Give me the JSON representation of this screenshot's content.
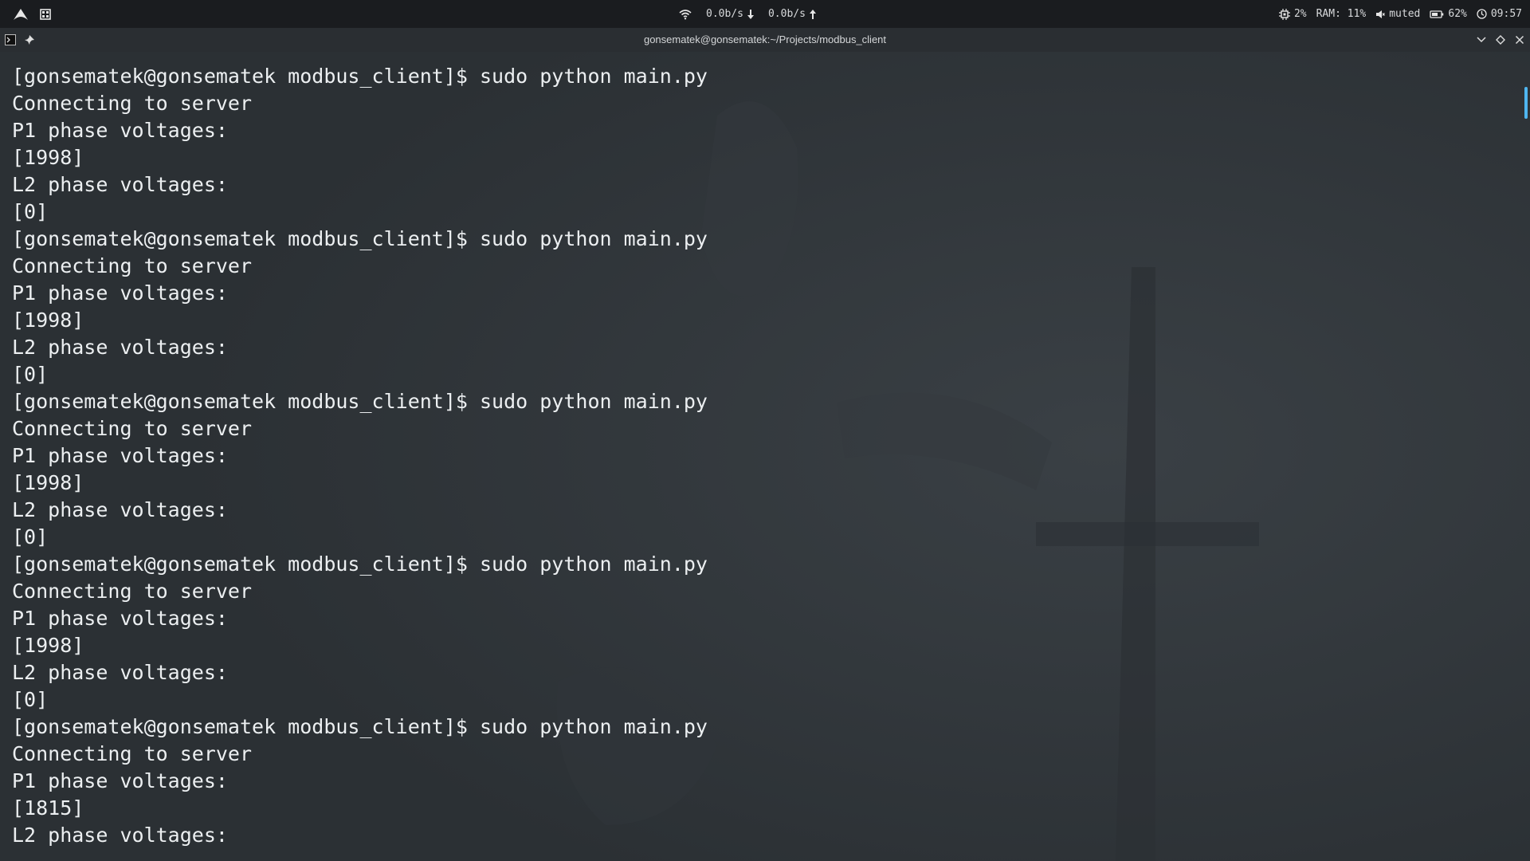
{
  "topbar": {
    "network_down": "0.0b/s",
    "network_up": "0.0b/s",
    "cpu": "2%",
    "ram": "RAM: 11%",
    "volume": "muted",
    "battery": "62%",
    "clock": "09:57",
    "icons": [
      "arch-logo-icon",
      "workspace-grid-icon",
      "wifi-icon",
      "arrow-down-icon",
      "arrow-up-icon",
      "cpu-icon",
      "speaker-icon",
      "battery-icon",
      "clock-icon"
    ]
  },
  "window": {
    "title": "gonsematek@gonsematek:~/Projects/modbus_client",
    "icons": [
      "terminal-icon",
      "pin-icon",
      "chevron-down-icon",
      "diamond-icon",
      "close-icon"
    ]
  },
  "terminal": {
    "lines": [
      "[gonsematek@gonsematek modbus_client]$ sudo python main.py",
      "Connecting to server",
      "P1 phase voltages:",
      "[1998]",
      "L2 phase voltages:",
      "[0]",
      "[gonsematek@gonsematek modbus_client]$ sudo python main.py",
      "Connecting to server",
      "P1 phase voltages:",
      "[1998]",
      "L2 phase voltages:",
      "[0]",
      "[gonsematek@gonsematek modbus_client]$ sudo python main.py",
      "Connecting to server",
      "P1 phase voltages:",
      "[1998]",
      "L2 phase voltages:",
      "[0]",
      "[gonsematek@gonsematek modbus_client]$ sudo python main.py",
      "Connecting to server",
      "P1 phase voltages:",
      "[1998]",
      "L2 phase voltages:",
      "[0]",
      "[gonsematek@gonsematek modbus_client]$ sudo python main.py",
      "Connecting to server",
      "P1 phase voltages:",
      "[1815]",
      "L2 phase voltages:"
    ]
  },
  "colors": {
    "panel_bg": "#1a1c1f",
    "terminal_bg": "#2f3438",
    "terminal_fg": "#eceff1",
    "accent": "#4fb6f0"
  }
}
